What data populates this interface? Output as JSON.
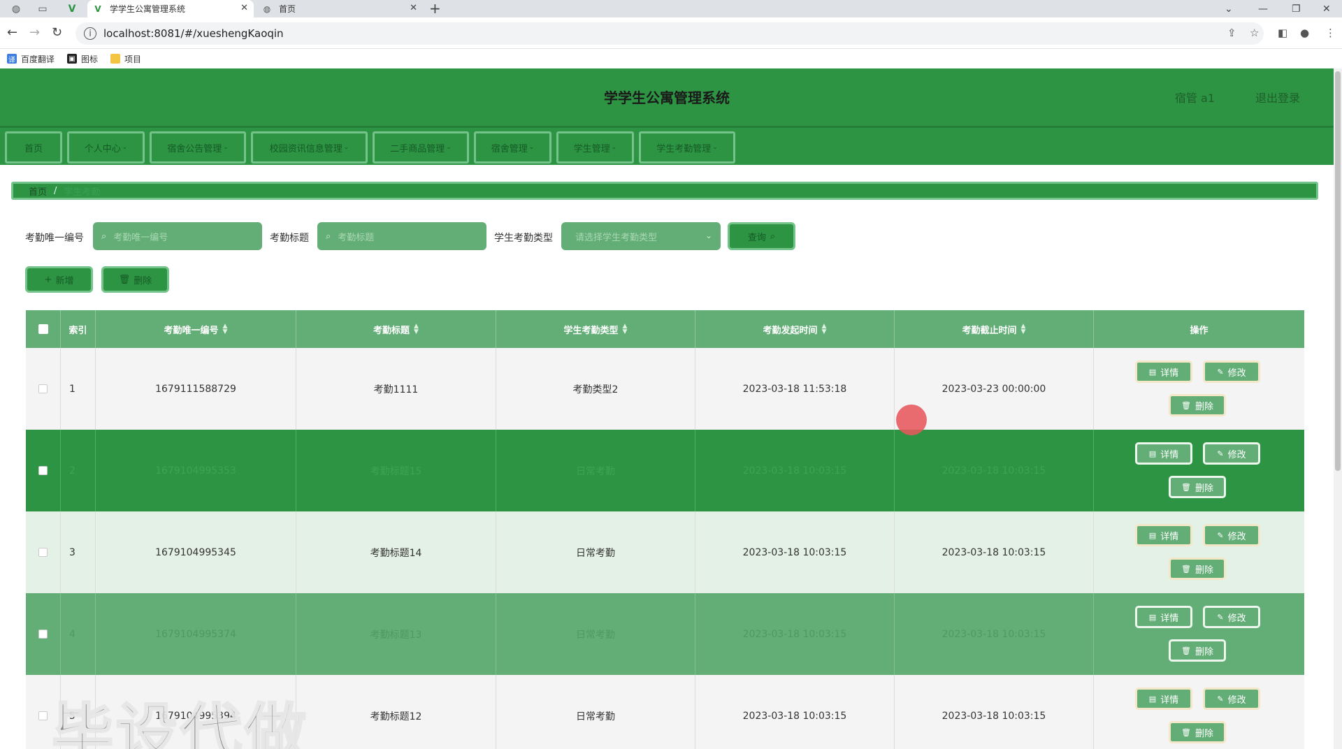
{
  "browser": {
    "tabs": [
      {
        "title": "学学生公寓管理系统",
        "active": true
      },
      {
        "title": "首页",
        "active": false
      }
    ],
    "url": "localhost:8081/#/xueshengKaoqin",
    "bookmarks": [
      "百度翻译",
      "图标",
      "项目"
    ]
  },
  "header": {
    "title": "学学生公寓管理系统",
    "user": "宿管 a1",
    "logout": "退出登录"
  },
  "menu": [
    {
      "label": "首页",
      "has_dropdown": false
    },
    {
      "label": "个人中心",
      "has_dropdown": true
    },
    {
      "label": "宿舍公告管理",
      "has_dropdown": true
    },
    {
      "label": "校园资讯信息管理",
      "has_dropdown": true
    },
    {
      "label": "二手商品管理",
      "has_dropdown": true
    },
    {
      "label": "宿舍管理",
      "has_dropdown": true
    },
    {
      "label": "学生管理",
      "has_dropdown": true
    },
    {
      "label": "学生考勤管理",
      "has_dropdown": true
    }
  ],
  "breadcrumb": {
    "home": "首页",
    "separator": "/",
    "current": "学生考勤"
  },
  "search": {
    "field1_label": "考勤唯一编号",
    "field1_placeholder": "考勤唯一编号",
    "field2_label": "考勤标题",
    "field2_placeholder": "考勤标题",
    "field3_label": "学生考勤类型",
    "field3_placeholder": "请选择学生考勤类型",
    "query_label": "查询"
  },
  "actions": {
    "add_label": "新增",
    "delete_label": "删除"
  },
  "table": {
    "columns": [
      "索引",
      "考勤唯一编号",
      "考勤标题",
      "学生考勤类型",
      "考勤发起时间",
      "考勤截止时间",
      "操作"
    ],
    "rows": [
      {
        "index": "1",
        "code": "1679111588729",
        "title": "考勤1111",
        "type": "考勤类型2",
        "start": "2023-03-18 11:53:18",
        "end": "2023-03-23 00:00:00"
      },
      {
        "index": "2",
        "code": "1679104995353",
        "title": "考勤标题15",
        "type": "日常考勤",
        "start": "2023-03-18 10:03:15",
        "end": "2023-03-18 10:03:15"
      },
      {
        "index": "3",
        "code": "1679104995345",
        "title": "考勤标题14",
        "type": "日常考勤",
        "start": "2023-03-18 10:03:15",
        "end": "2023-03-18 10:03:15"
      },
      {
        "index": "4",
        "code": "1679104995374",
        "title": "考勤标题13",
        "type": "日常考勤",
        "start": "2023-03-18 10:03:15",
        "end": "2023-03-18 10:03:15"
      },
      {
        "index": "5",
        "code": "1679104995394",
        "title": "考勤标题12",
        "type": "日常考勤",
        "start": "2023-03-18 10:03:15",
        "end": "2023-03-18 10:03:15"
      }
    ],
    "op_detail": "详情",
    "op_edit": "修改",
    "op_delete": "删除"
  },
  "watermark": "毕设代做",
  "colors": {
    "primary": "#2d9443",
    "header_row": "#63ad77",
    "accent_border": "#74c38a"
  }
}
